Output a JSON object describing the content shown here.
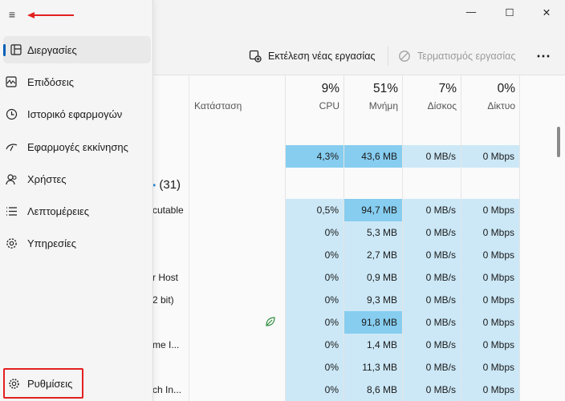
{
  "window": {
    "minimize_glyph": "—",
    "maximize_glyph": "☐",
    "close_glyph": "✕"
  },
  "toolbar": {
    "run_new_task": "Εκτέλεση νέας εργασίας",
    "end_task": "Τερματισμός εργασίας",
    "more": "⋯"
  },
  "table": {
    "status_header": "Κατάσταση",
    "columns": [
      {
        "percent": "9%",
        "label": "CPU"
      },
      {
        "percent": "51%",
        "label": "Μνήμη"
      },
      {
        "percent": "7%",
        "label": "Δίσκος"
      },
      {
        "percent": "0%",
        "label": "Δίκτυο"
      }
    ],
    "group_count": "(31)",
    "top_row": {
      "cpu": "4,3%",
      "mem": "43,6 MB",
      "disk": "0 MB/s",
      "net": "0 Mbps"
    },
    "rows": [
      {
        "name": "cutable",
        "cpu": "0,5%",
        "mem": "94,7 MB",
        "disk": "0 MB/s",
        "net": "0 Mbps"
      },
      {
        "name": "",
        "cpu": "0%",
        "mem": "5,3 MB",
        "disk": "0 MB/s",
        "net": "0 Mbps"
      },
      {
        "name": "",
        "cpu": "0%",
        "mem": "2,7 MB",
        "disk": "0 MB/s",
        "net": "0 Mbps"
      },
      {
        "name": "r Host",
        "cpu": "0%",
        "mem": "0,9 MB",
        "disk": "0 MB/s",
        "net": "0 Mbps"
      },
      {
        "name": "2 bit)",
        "cpu": "0%",
        "mem": "9,3 MB",
        "disk": "0 MB/s",
        "net": "0 Mbps"
      },
      {
        "name": "",
        "cpu": "0%",
        "mem": "91,8 MB",
        "disk": "0 MB/s",
        "net": "0 Mbps"
      },
      {
        "name": "me I...",
        "cpu": "0%",
        "mem": "1,4 MB",
        "disk": "0 MB/s",
        "net": "0 Mbps"
      },
      {
        "name": "",
        "cpu": "0%",
        "mem": "11,3 MB",
        "disk": "0 MB/s",
        "net": "0 Mbps"
      },
      {
        "name": "ch In...",
        "cpu": "0%",
        "mem": "8,6 MB",
        "disk": "0 MB/s",
        "net": "0 Mbps"
      }
    ]
  },
  "nav": {
    "menu_glyph": "≡",
    "items": [
      {
        "label": "Διεργασίες",
        "icon": "processes-icon"
      },
      {
        "label": "Επιδόσεις",
        "icon": "performance-icon"
      },
      {
        "label": "Ιστορικό εφαρμογών",
        "icon": "history-icon"
      },
      {
        "label": "Εφαρμογές εκκίνησης",
        "icon": "startup-icon"
      },
      {
        "label": "Χρήστες",
        "icon": "users-icon"
      },
      {
        "label": "Λεπτομέρειες",
        "icon": "details-icon"
      },
      {
        "label": "Υπηρεσίες",
        "icon": "services-icon"
      }
    ],
    "settings": "Ρυθμίσεις"
  },
  "colors": {
    "accent": "#005fb8",
    "heat_light": "#cce8f7",
    "heat_medium": "#86cdf0",
    "highlight_red": "#e32020"
  }
}
